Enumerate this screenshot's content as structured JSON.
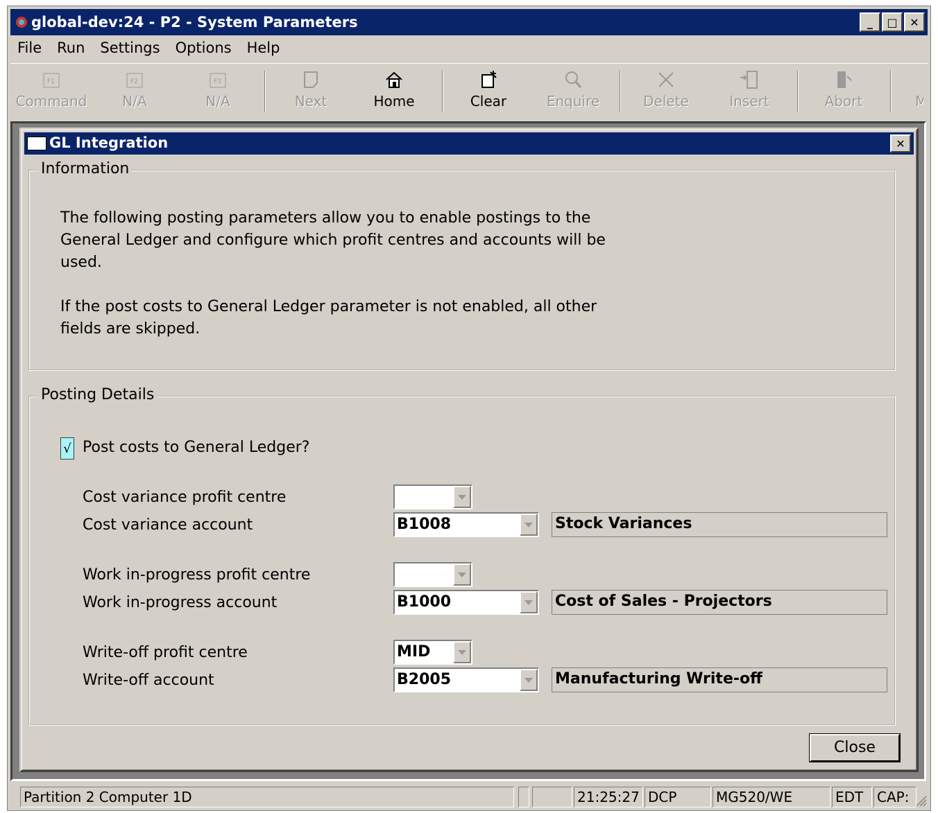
{
  "window": {
    "title": "global-dev:24 - P2 - System Parameters",
    "minimize": "_",
    "maximize": "□",
    "close": "✕"
  },
  "menu": [
    "File",
    "Run",
    "Settings",
    "Options",
    "Help"
  ],
  "toolbar": [
    {
      "label": "Command",
      "icon": "f1-key-icon",
      "key": "F1",
      "enabled": false
    },
    {
      "label": "N/A",
      "icon": "f2-key-icon",
      "key": "F2",
      "enabled": false
    },
    {
      "label": "N/A",
      "icon": "f3-key-icon",
      "key": "F3",
      "enabled": false
    },
    {
      "label": "Next",
      "icon": "next-page-icon",
      "enabled": false
    },
    {
      "label": "Home",
      "icon": "home-icon",
      "enabled": true
    },
    {
      "label": "Clear",
      "icon": "clear-icon",
      "enabled": true
    },
    {
      "label": "Enquire",
      "icon": "magnifier-icon",
      "enabled": false
    },
    {
      "label": "Delete",
      "icon": "delete-x-icon",
      "enabled": false
    },
    {
      "label": "Insert",
      "icon": "insert-icon",
      "enabled": false
    },
    {
      "label": "Abort",
      "icon": "door-exit-icon",
      "enabled": false
    },
    {
      "label": "M",
      "icon": "",
      "enabled": false
    }
  ],
  "dialog": {
    "title": "GL Integration",
    "close": "✕",
    "information": {
      "legend": "Information",
      "para1_line1": "The following posting parameters allow you to enable postings to the",
      "para1_line2": "General Ledger and configure which profit centres and accounts will be",
      "para1_line3": "used.",
      "para2_line1": "If the post costs to General Ledger parameter is not enabled, all other",
      "para2_line2": "fields are skipped."
    },
    "posting": {
      "legend": "Posting Details",
      "post_costs_label": "Post costs to General Ledger?",
      "post_costs_checked": true,
      "check_mark": "√",
      "fields": [
        {
          "pc_label": "Cost variance profit centre",
          "pc_value": "",
          "acct_label": "Cost variance account",
          "acct_value": "B1008",
          "acct_desc": "Stock Variances"
        },
        {
          "pc_label": "Work in-progress profit centre",
          "pc_value": "",
          "acct_label": "Work in-progress account",
          "acct_value": "B1000",
          "acct_desc": "Cost of Sales - Projectors"
        },
        {
          "pc_label": "Write-off profit centre",
          "pc_value": "MID",
          "acct_label": "Write-off account",
          "acct_value": "B2005",
          "acct_desc": "Manufacturing Write-off"
        }
      ]
    },
    "close_button": "Close"
  },
  "statusbar": {
    "message": "Partition 2 Computer 1D",
    "time": "21:25:27",
    "mode": "DCP",
    "program": "MG520/WE",
    "edit": "EDT",
    "caps": "CAP:"
  }
}
